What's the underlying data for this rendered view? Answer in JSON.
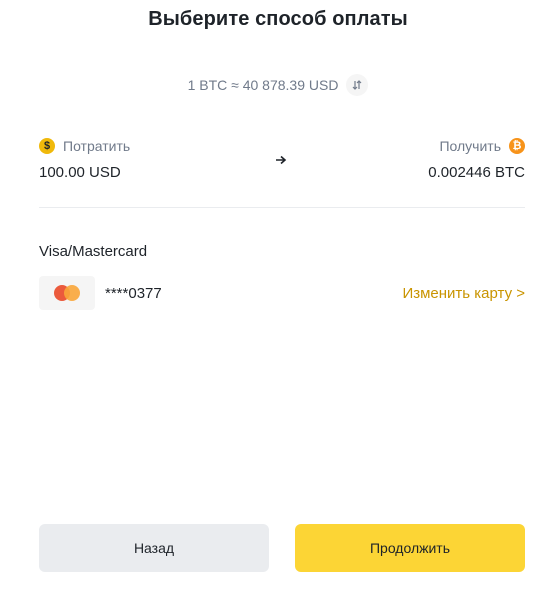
{
  "header": {
    "title": "Выберите способ оплаты"
  },
  "rate": {
    "text": "1 BTC ≈ 40 878.39 USD"
  },
  "spend": {
    "label": "Потратить",
    "amount": "100.00 USD",
    "coin_symbol": "$"
  },
  "receive": {
    "label": "Получить",
    "amount": "0.002446 BTC",
    "coin_symbol": "₿"
  },
  "payment": {
    "method_title": "Visa/Mastercard",
    "card_number": "****0377",
    "change_card_label": "Изменить карту >"
  },
  "buttons": {
    "back_label": "Назад",
    "continue_label": "Продолжить"
  },
  "colors": {
    "accent_yellow": "#fcd535",
    "link_gold": "#c99400",
    "secondary_button": "#eaecef"
  }
}
